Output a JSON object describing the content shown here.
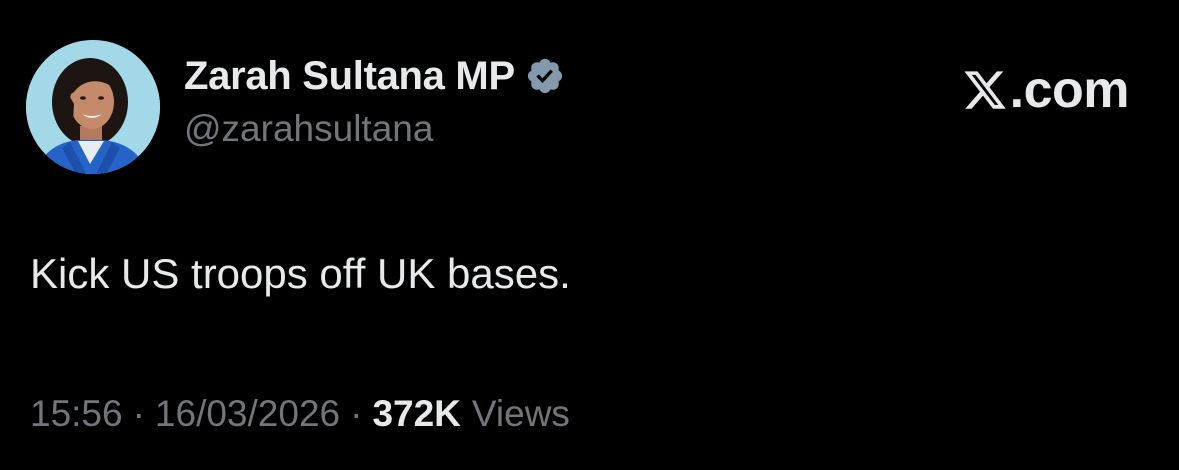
{
  "author": {
    "display_name": "Zarah Sultana MP",
    "handle": "@zarahsultana",
    "verified": true,
    "avatar_icon": "profile-photo"
  },
  "brand": {
    "logo_icon": "x-logo-icon",
    "text": ".com"
  },
  "tweet": {
    "text": "Kick US troops off UK bases."
  },
  "meta": {
    "time": "15:56",
    "separator": "·",
    "date": "16/03/2026",
    "views_count": "372K",
    "views_label": "Views"
  },
  "colors": {
    "background": "#000000",
    "primary_text": "#e7e9ea",
    "secondary_text": "#71767b",
    "verified_badge": "#829aab",
    "avatar_bg": "#9fd6e6"
  }
}
